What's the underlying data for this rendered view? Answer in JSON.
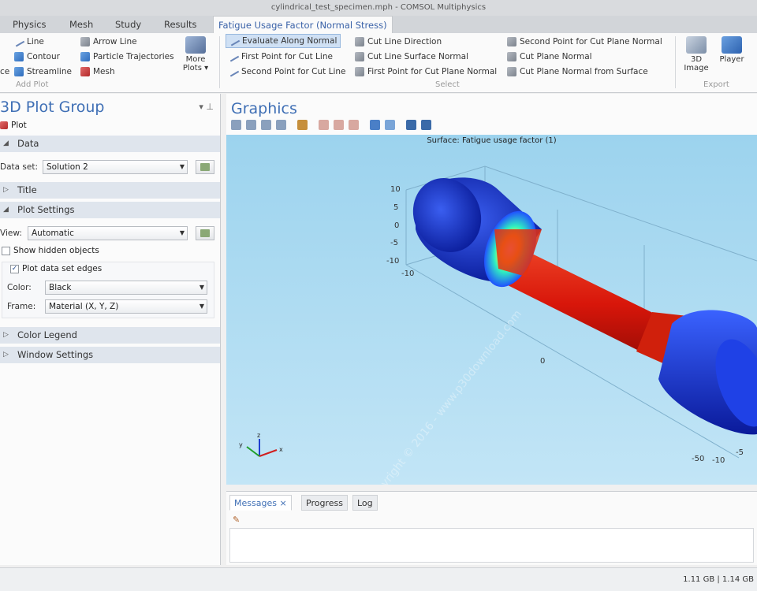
{
  "window": {
    "title": "cylindrical_test_specimen.mph - COMSOL Multiphysics"
  },
  "tabs": [
    "Physics",
    "Mesh",
    "Study",
    "Results",
    "Fatigue Usage Factor (Normal Stress)"
  ],
  "ribbon": {
    "add_plot": {
      "items": [
        "Line",
        "Contour",
        "Streamline",
        "Arrow Line",
        "Particle Trajectories",
        "Mesh"
      ],
      "edge_fragment": "ce",
      "more_plots": "More Plots",
      "label": "Add Plot"
    },
    "select": {
      "items": [
        "Evaluate Along Normal",
        "First Point for Cut Line",
        "Second Point for Cut Line",
        "Cut Line Direction",
        "Cut Line Surface Normal",
        "First Point for Cut Plane Normal",
        "Second Point for Cut Plane Normal",
        "Cut Plane Normal",
        "Cut Plane Normal from Surface"
      ],
      "label": "Select"
    },
    "export": {
      "image_3d": "3D Image",
      "player": "Player",
      "label": "Export"
    }
  },
  "left_panel": {
    "title": "3D Plot Group",
    "plot_label": "Plot",
    "sections": {
      "data": "Data",
      "title": "Title",
      "plot_settings": "Plot Settings",
      "color_legend": "Color Legend",
      "window_settings": "Window Settings"
    },
    "data_set_label": "Data set:",
    "data_set_value": "Solution 2",
    "view_label": "View:",
    "view_value": "Automatic",
    "show_hidden": "Show hidden objects",
    "plot_edges": "Plot data set edges",
    "color_label": "Color:",
    "color_value": "Black",
    "frame_label": "Frame:",
    "frame_value": "Material  (X, Y, Z)"
  },
  "graphics": {
    "title": "Graphics",
    "caption": "Surface: Fatigue usage factor (1)",
    "axis_ticks": [
      "10",
      "5",
      "0",
      "-5",
      "-10",
      "-10",
      "0",
      "-50",
      "-10",
      "-5"
    ],
    "triad": {
      "z": "z",
      "y": "y",
      "x": "x"
    },
    "watermark": "Copyright © 2016 - www.p30download.com"
  },
  "messages": {
    "tabs": [
      "Messages",
      "Progress",
      "Log"
    ]
  },
  "status": {
    "memory": "1.11 GB | 1.14 GB"
  },
  "colors": {
    "accent": "#3f6fb5",
    "viewport_bg": "#a9dcf2",
    "specimen_red": "#d9180c",
    "specimen_blue": "#1a3dd6"
  }
}
